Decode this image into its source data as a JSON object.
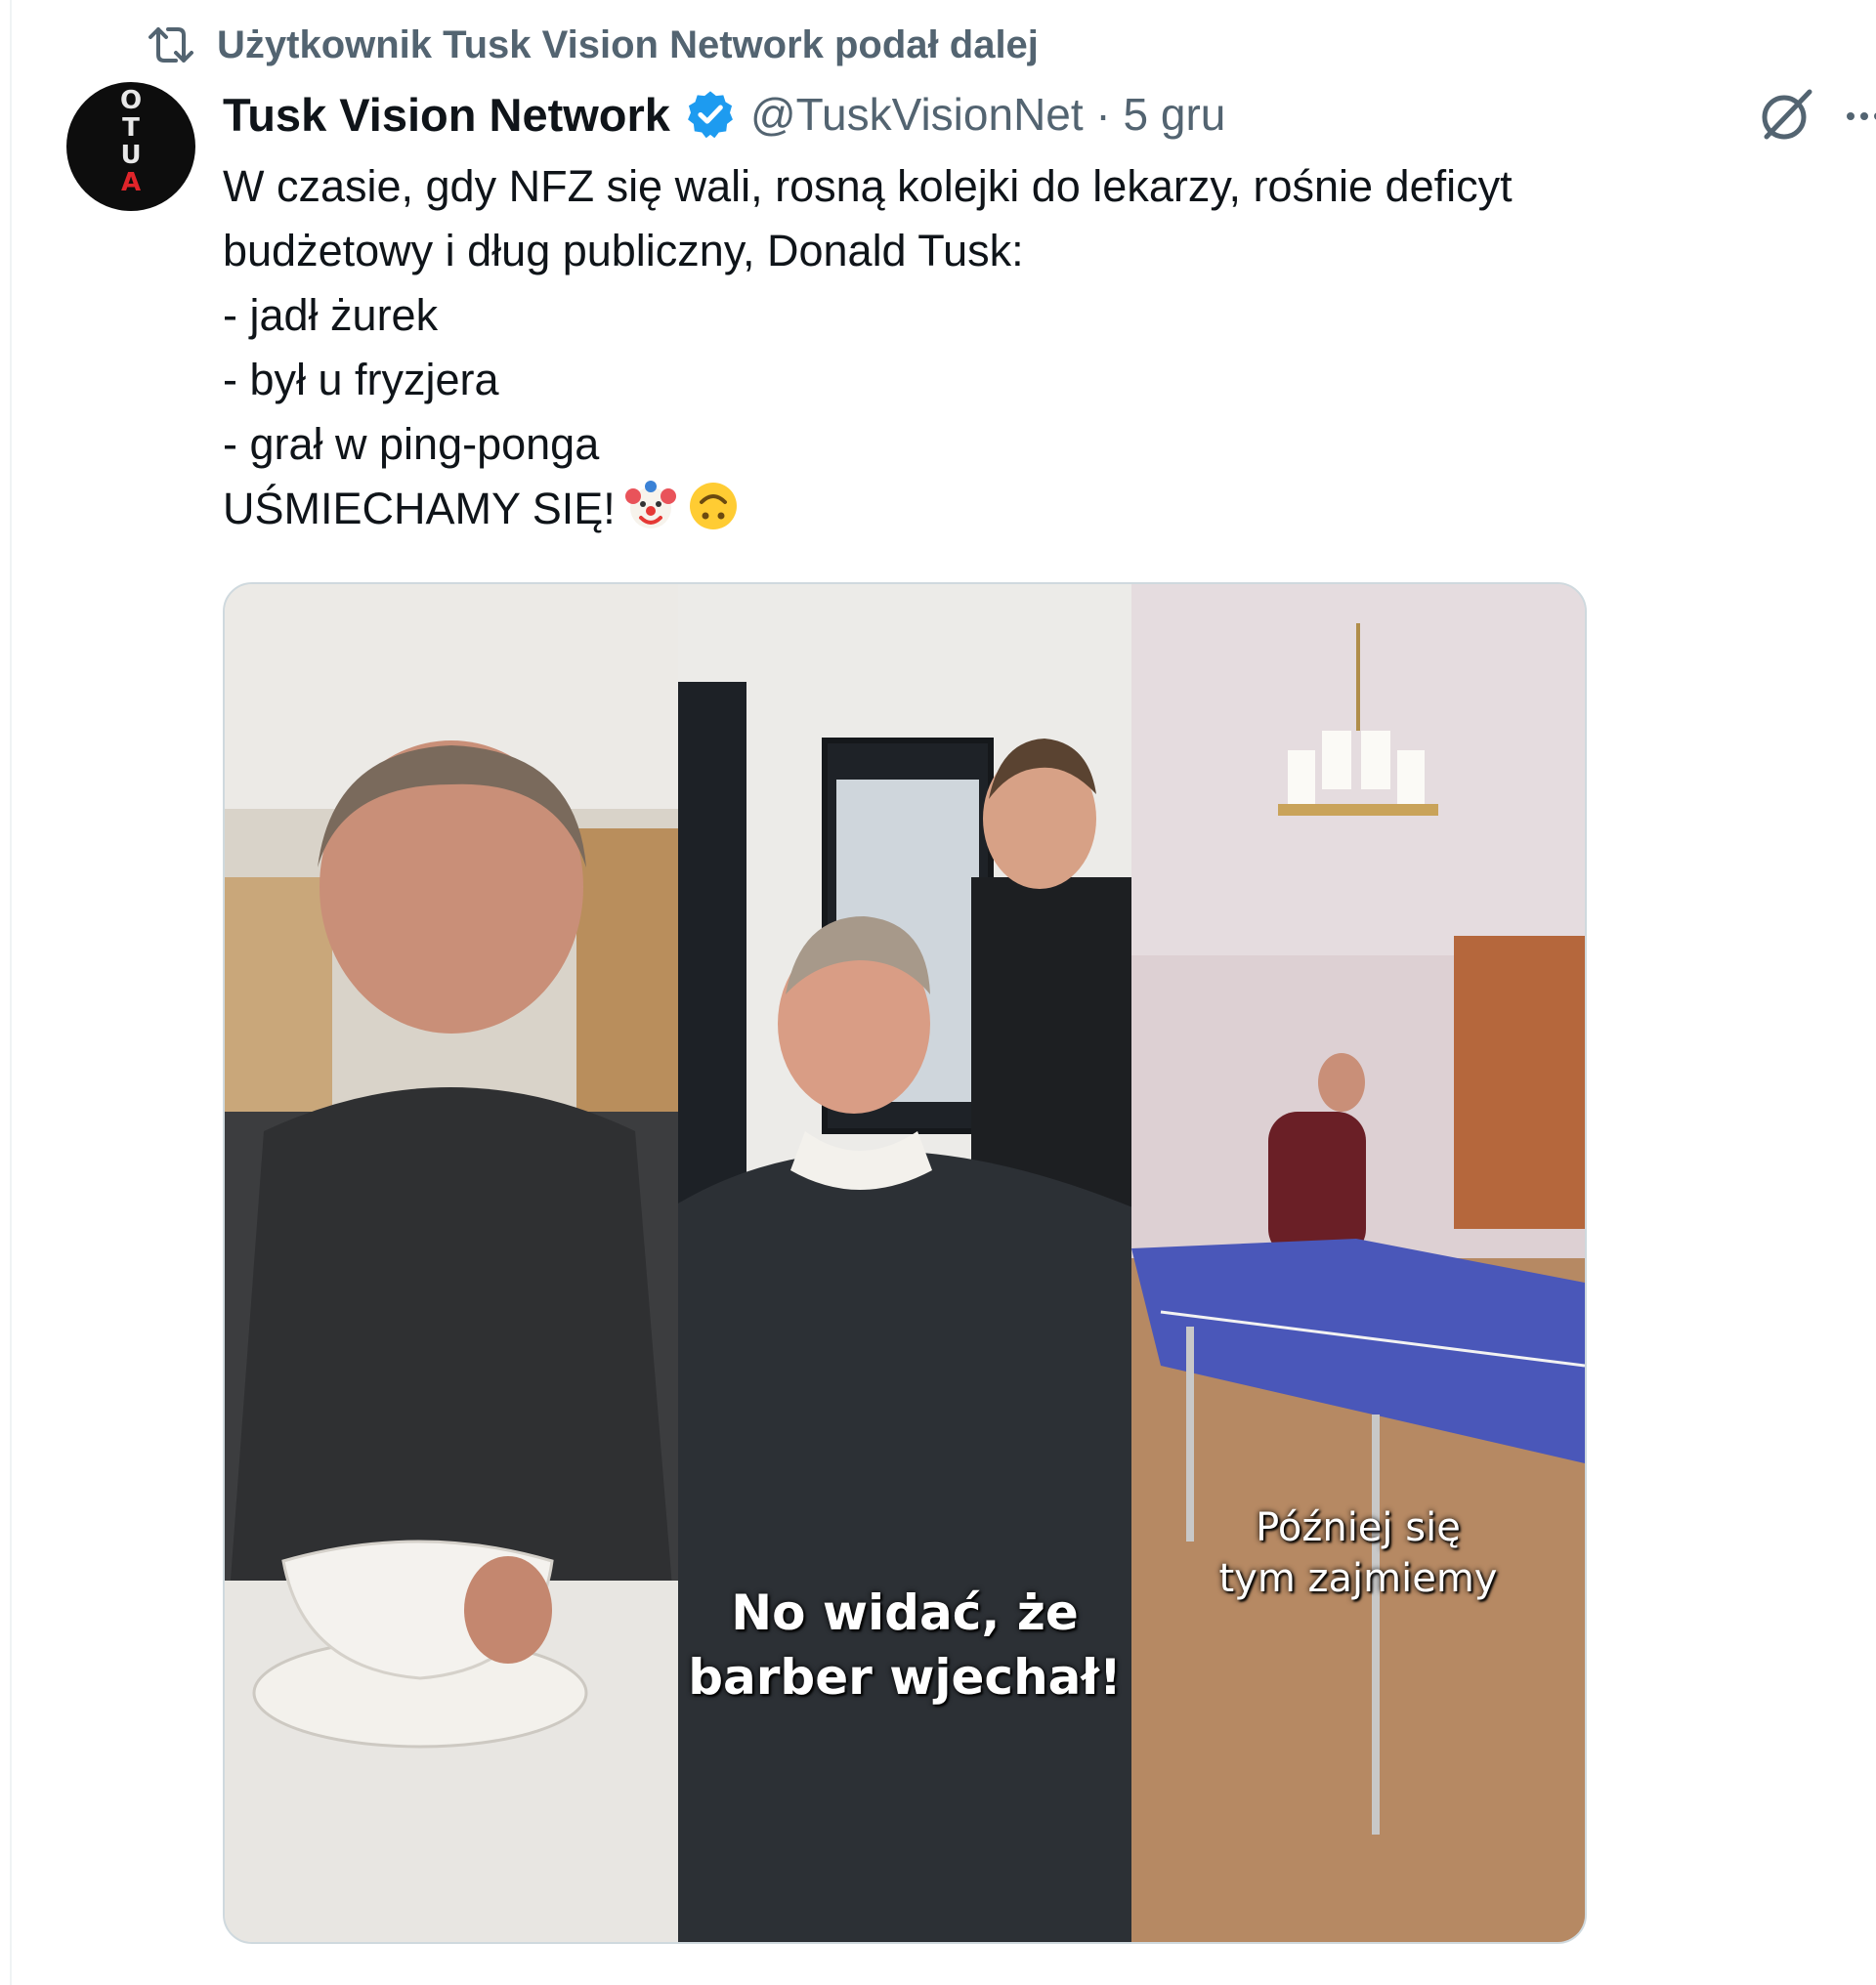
{
  "repost": {
    "icon": "repost-icon",
    "text": "Użytkownik Tusk Vision Network podał dalej"
  },
  "author": {
    "avatar_letters": [
      "O",
      "T",
      "U",
      "A"
    ],
    "display_name": "Tusk Vision Network",
    "verified_icon": "verified-badge-icon",
    "handle_and_time": "@TuskVisionNet · 5 gru"
  },
  "actions": {
    "grok_icon": "grok-icon",
    "more_icon": "more-icon"
  },
  "tweet": {
    "lines": [
      "W czasie, gdy NFZ się wali, rosną kolejki do lekarzy, rośnie deficyt",
      "budżetowy i dług publiczny, Donald Tusk:",
      "- jadł żurek",
      "- był u fryzjera",
      "- grał w ping-ponga",
      "UŚMIECHAMY SIĘ!"
    ],
    "emojis": [
      "clown-face-emoji",
      "upside-down-face-emoji"
    ]
  },
  "media": {
    "panel_2_caption": [
      "No widać, że",
      "barber wjechał!"
    ],
    "panel_3_caption": [
      "Później się",
      "tym zajmiemy"
    ]
  },
  "colors": {
    "text_primary": "#0f1419",
    "text_secondary": "#536471",
    "verified_blue": "#1d9bf0",
    "border": "#cfd9de"
  }
}
